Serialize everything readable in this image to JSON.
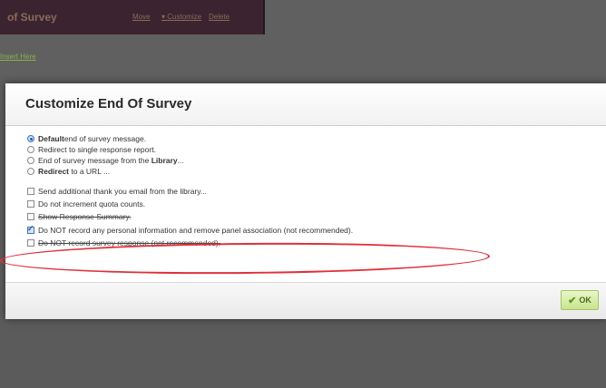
{
  "background": {
    "title": "of Survey",
    "menu": [
      "Move",
      "Customize",
      "Delete"
    ],
    "link": "Insert Here"
  },
  "dialog": {
    "title": "Customize End Of Survey",
    "radios": [
      {
        "bold": "Default",
        "text": " end of survey message.",
        "selected": true
      },
      {
        "bold": "",
        "text": "Redirect to single response report.",
        "selected": false
      },
      {
        "bold": "",
        "text": "End of survey message from the ",
        "bold2": "Library",
        "text2": "...",
        "selected": false
      },
      {
        "bold": "Redirect",
        "text": " to a URL ...",
        "selected": false
      }
    ],
    "checks": [
      {
        "text": "Send additional thank you email from the library...",
        "checked": false
      },
      {
        "text": "Do not increment quota counts.",
        "checked": false
      },
      {
        "text": "Show Response Summary.",
        "checked": false
      },
      {
        "text": "Do NOT record any personal information and remove panel association (not recommended).",
        "checked": true
      },
      {
        "text": "Do NOT record survey response (not recommended).",
        "checked": false
      }
    ],
    "ok_label": "OK"
  },
  "colors": {
    "highlight": "#e0303a",
    "ok_green": "#c9e48e"
  }
}
